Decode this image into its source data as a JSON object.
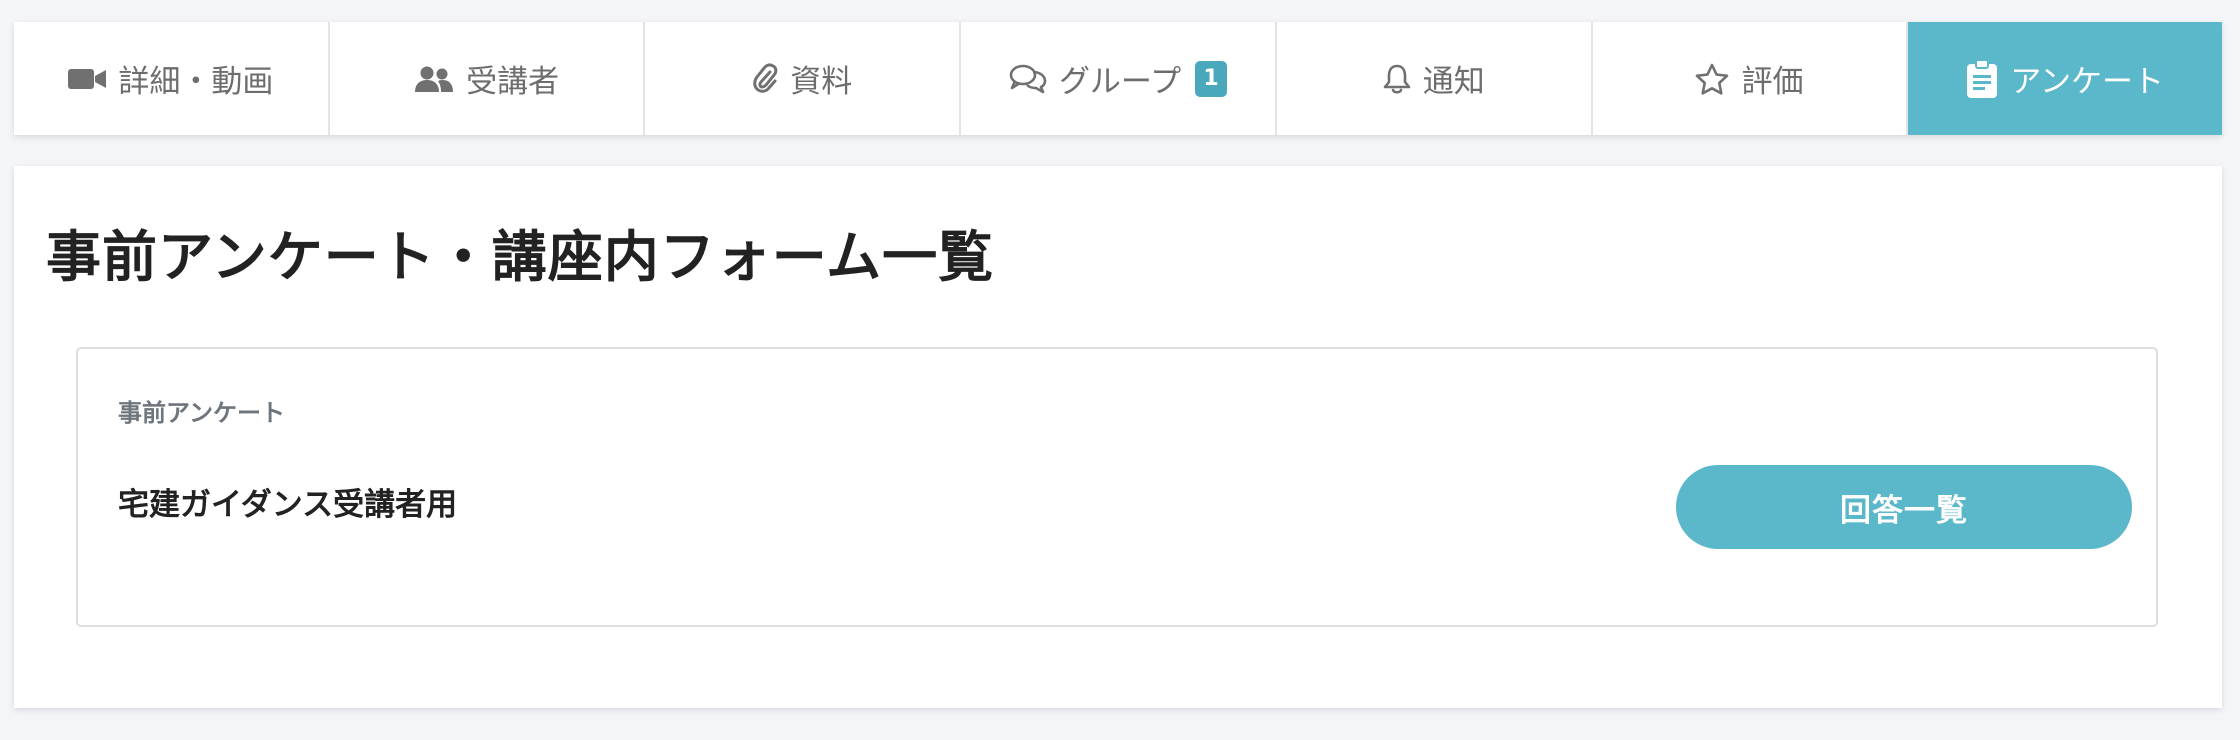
{
  "tabs": [
    {
      "label": "詳細・動画",
      "icon": "video-camera-icon",
      "active": false
    },
    {
      "label": "受講者",
      "icon": "users-icon",
      "active": false
    },
    {
      "label": "資料",
      "icon": "paperclip-icon",
      "active": false
    },
    {
      "label": "グループ",
      "icon": "chat-bubbles-icon",
      "badge": "1",
      "active": false
    },
    {
      "label": "通知",
      "icon": "bell-icon",
      "active": false
    },
    {
      "label": "評価",
      "icon": "star-icon",
      "active": false
    },
    {
      "label": "アンケート",
      "icon": "clipboard-icon",
      "active": true
    }
  ],
  "page": {
    "title": "事前アンケート・講座内フォーム一覧"
  },
  "survey_card": {
    "category": "事前アンケート",
    "name": "宅建ガイダンス受講者用",
    "button_label": "回答一覧"
  },
  "colors": {
    "accent": "#5bb8cb",
    "badge": "#4aa8bd",
    "tab_text": "#6d6d6d",
    "background": "#f4f5f8"
  }
}
